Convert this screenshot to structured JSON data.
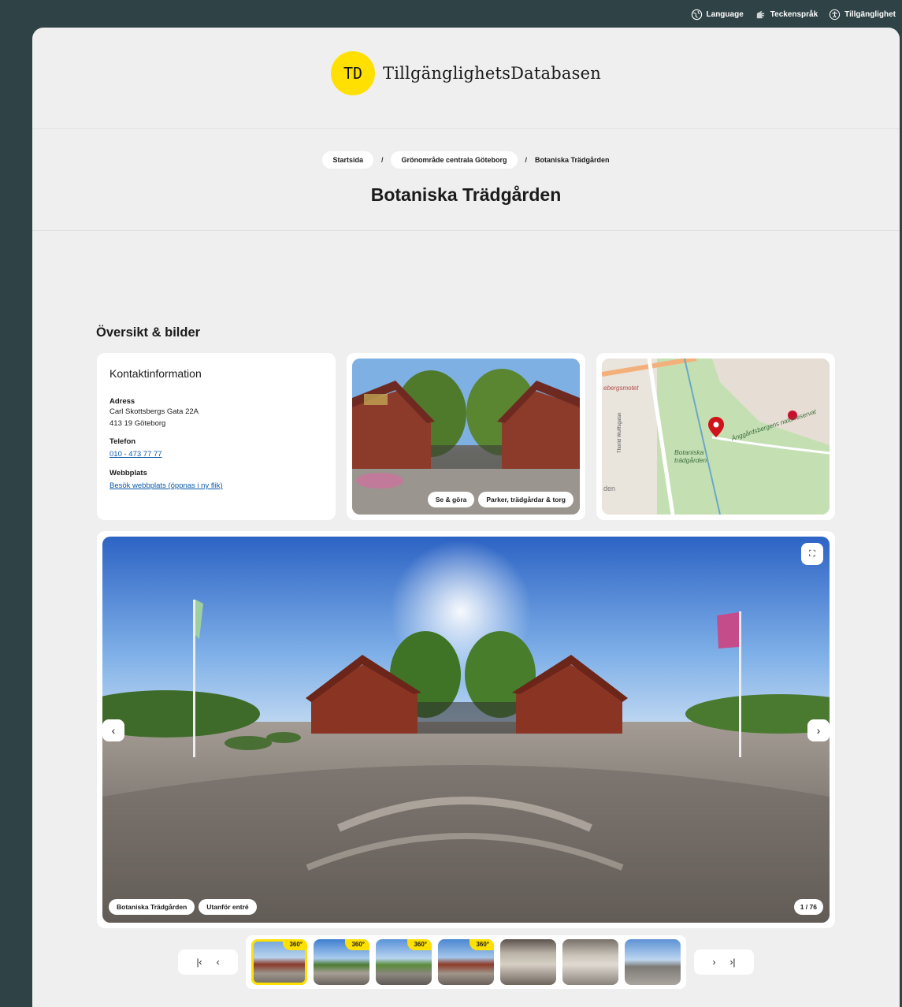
{
  "util_bar": {
    "language": "Language",
    "sign_language": "Teckenspråk",
    "accessibility": "Tillgänglighet"
  },
  "logo": {
    "badge": "TD",
    "name": "TillgänglighetsDatabasen"
  },
  "breadcrumb": {
    "home": "Startsida",
    "parent": "Grönområde centrala Göteborg",
    "current": "Botaniska Trädgården",
    "separator": "/"
  },
  "page_title": "Botaniska Trädgården",
  "section_title": "Översikt & bilder",
  "contact": {
    "heading": "Kontaktinformation",
    "address_label": "Adress",
    "address_line1": "Carl Skottsbergs Gata 22A",
    "address_line2": "413 19 Göteborg",
    "phone_label": "Telefon",
    "phone": "010 - 473 77 77",
    "web_label": "Webbplats",
    "web_link": "Besök webbplats (öppnas i ny flik)"
  },
  "photo_tags": [
    "Se & göra",
    "Parker, trädgårdar & torg"
  ],
  "map": {
    "labels": [
      "ebergsmotet",
      "Botaniska trädgården",
      "Änggårdsbergens naturreservat",
      "den",
      "Thorild Wulffsgatan"
    ]
  },
  "panorama": {
    "tags": [
      "Botaniska Trädgården",
      "Utanför entré"
    ],
    "counter": "1 / 76"
  },
  "thumbnails": [
    {
      "badge": "360°",
      "active": true
    },
    {
      "badge": "360°",
      "active": false
    },
    {
      "badge": "360°",
      "active": false
    },
    {
      "badge": "360°",
      "active": false
    },
    {
      "badge": "",
      "active": false
    },
    {
      "badge": "",
      "active": false
    },
    {
      "badge": "",
      "active": false
    }
  ],
  "colors": {
    "accent": "#ffe001",
    "frame": "#2f4246",
    "page": "#efefef",
    "link": "#0b5aa8"
  }
}
